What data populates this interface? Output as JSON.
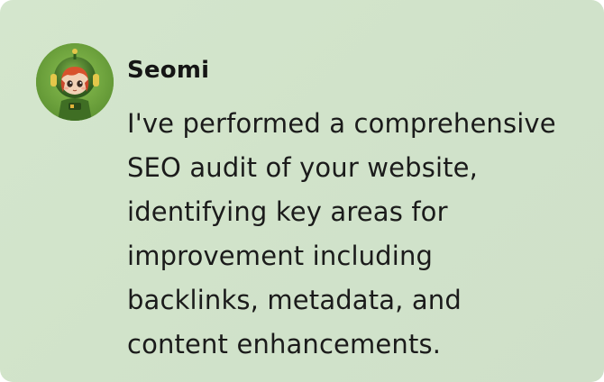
{
  "message": {
    "sender_name": "Seomi",
    "text": "I've performed a comprehensive\nSEO audit of your website,\nidentifying key areas for\nimprovement including\nbacklinks, metadata, and\ncontent enhancements.",
    "avatar_icon": "robot-girl-avatar-icon"
  },
  "colors": {
    "card_background": "#d2e4cb",
    "avatar_background": "#6fa53f",
    "text": "#151515"
  }
}
